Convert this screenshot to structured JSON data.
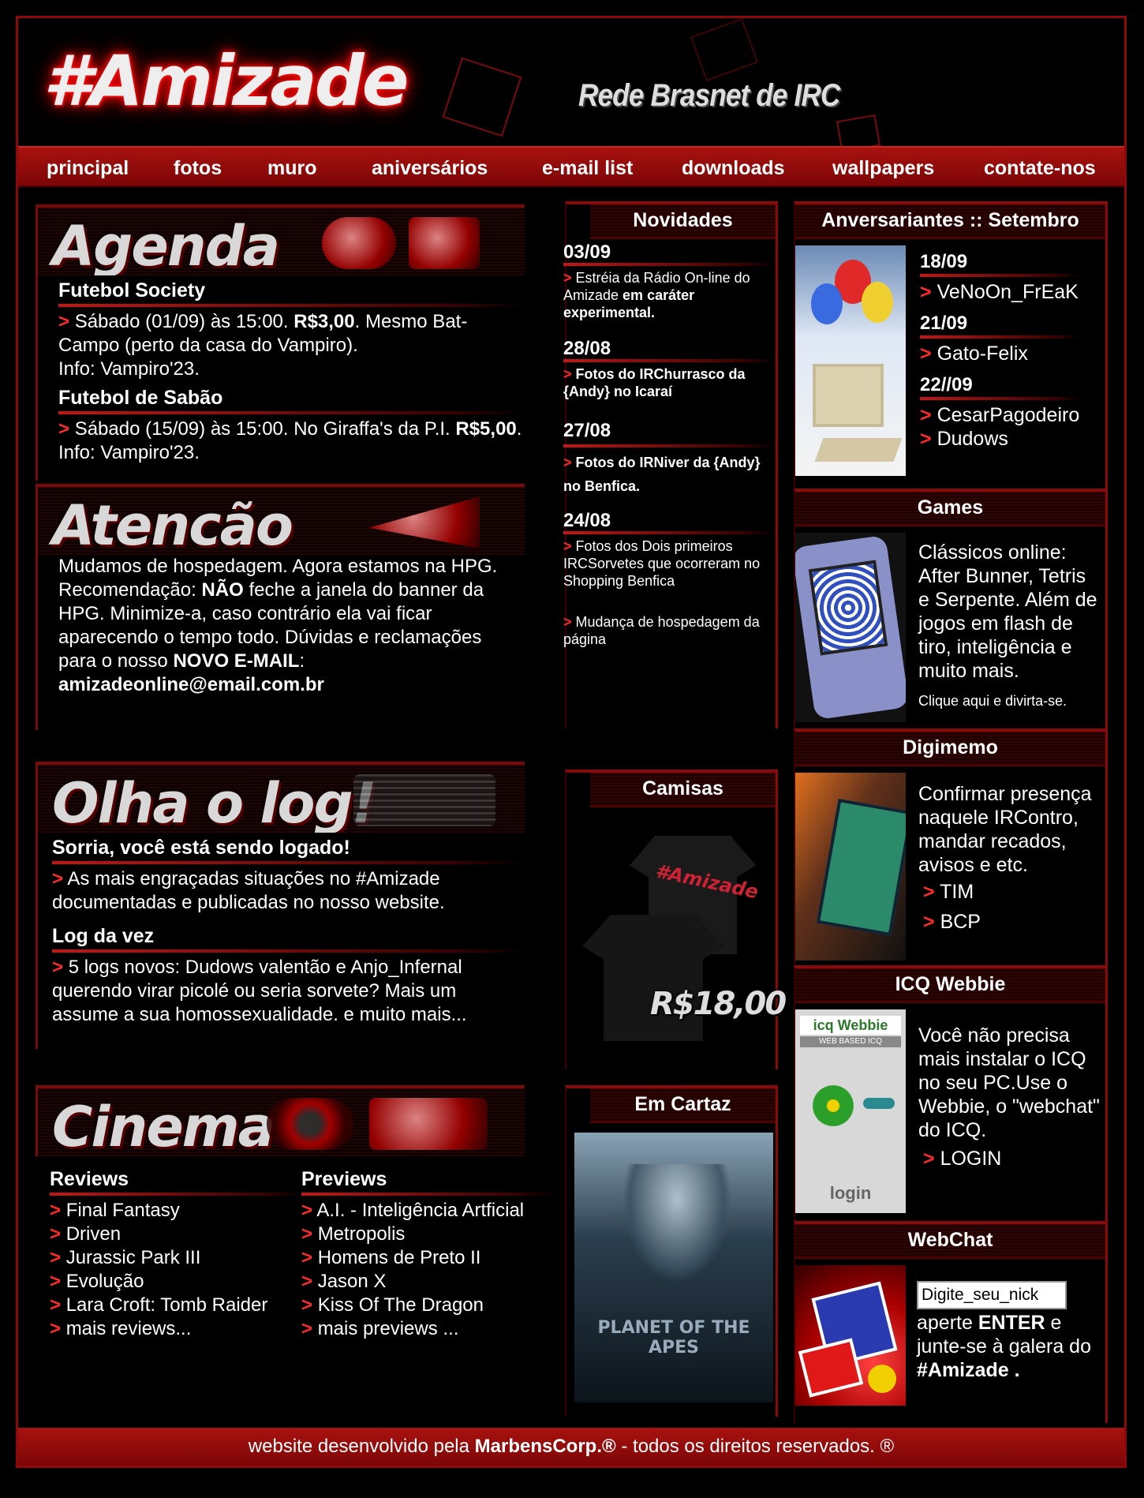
{
  "header": {
    "logo": "#Amizade",
    "tagline": "Rede Brasnet de IRC"
  },
  "nav": [
    {
      "label": "principal"
    },
    {
      "label": "fotos"
    },
    {
      "label": "muro"
    },
    {
      "label": "aniversários"
    },
    {
      "label": "e-mail list"
    },
    {
      "label": "downloads"
    },
    {
      "label": "wallpapers"
    },
    {
      "label": "contate-nos"
    }
  ],
  "agenda": {
    "title": "Agenda",
    "events": [
      {
        "title": "Futebol Society",
        "text1": "Sábado (01/09) às 15:00. ",
        "price": "R$3,00",
        "text2": ". Mesmo Bat-Campo (perto da casa do Vampiro).",
        "info": "Info: Vampiro'23."
      },
      {
        "title": "Futebol de Sabão",
        "text1": "Sábado (15/09) às 15:00. No Giraffa's da P.I.",
        "price": "R$5,00",
        "text2": ". Info: Vampiro'23."
      }
    ]
  },
  "atencao": {
    "title": "Atencão",
    "p1": "Mudamos de hospedagem. Agora estamos na HPG. Recomendação: ",
    "nao": "NÃO",
    "p2": " feche a janela do banner da HPG. Minimize-a, caso contrário ela vai ficar aparecendo o tempo todo. Dúvidas e reclamações para o nosso ",
    "novo": "NOVO E-MAIL",
    "colon": ":",
    "email": "amizadeonline@email.com.br"
  },
  "log": {
    "title": "Olha o log!",
    "sub1": "Sorria, você está sendo logado!",
    "text1": "As mais engraçadas situações no #Amizade documentadas e publicadas no nosso website.",
    "sub2": "Log da vez",
    "text2": "5 logs novos: Dudows valentão e Anjo_Infernal querendo virar picolé ou seria sorvete? Mais um assume a sua homossexualidade. e muito mais..."
  },
  "cinema": {
    "title": "Cinema",
    "reviews_title": "Reviews",
    "reviews": [
      "Final Fantasy",
      "Driven",
      "Jurassic Park III",
      "Evolução",
      "Lara Croft: Tomb Raider",
      "mais reviews..."
    ],
    "previews_title": "Previews",
    "previews": [
      "A.I. - Inteligência Artficial",
      "Metropolis",
      "Homens de Preto II",
      "Jason X",
      "Kiss Of The Dragon",
      "mais previews ..."
    ]
  },
  "novidades": {
    "title": "Novidades",
    "items": [
      {
        "date": "03/09",
        "text": "Estréia da Rádio On-line do Amizade ",
        "bold": "em caráter experimental."
      },
      {
        "date": "28/08",
        "text": "",
        "bold": "Fotos do IRChurrasco da {Andy} no Icaraí"
      },
      {
        "date": "27/08",
        "text": "",
        "bold": "Fotos do IRNiver da {Andy} no Benfica."
      },
      {
        "date": "24/08",
        "text": "Fotos dos Dois primeiros IRCSorvetes que ocorreram no Shopping Benfica",
        "bold": ""
      },
      {
        "date": "",
        "text": "Mudança de hospedagem da página",
        "bold": ""
      }
    ]
  },
  "camisas": {
    "title": "Camisas",
    "shirt_text": "#Amizade",
    "price": "R$18,00"
  },
  "cartaz": {
    "title": "Em Cartaz",
    "poster_title": "PLANET OF THE APES"
  },
  "aniversariantes": {
    "title": "Anversariantes :: Setembro",
    "groups": [
      {
        "date": "18/09",
        "names": [
          "VeNoOn_FrEaK"
        ]
      },
      {
        "date": "21/09",
        "names": [
          "Gato-Felix"
        ]
      },
      {
        "date": "22//09",
        "names": [
          "CesarPagodeiro",
          "Dudows"
        ]
      }
    ]
  },
  "games": {
    "title": "Games",
    "text": "Clássicos online: After Bunner, Tetris e Serpente. Além de jogos em flash de tiro, inteligência e muito mais.",
    "cta": "Clique aqui e divirta-se."
  },
  "digimemo": {
    "title": "Digimemo",
    "text": "Confirmar presença naquele IRContro, mandar recados, avisos e etc.",
    "links": [
      "TIM",
      "BCP"
    ]
  },
  "icq": {
    "title": "ICQ Webbie",
    "logo_text": "icq Webbie",
    "logo_sub": "WEB BASED ICQ",
    "login_img": "login",
    "text": "Você não precisa mais instalar o ICQ no seu PC.Use o Webbie, o \"webchat\" do ICQ.",
    "link": "LOGIN"
  },
  "webchat": {
    "title": "WebChat",
    "nick_value": "Digite_seu_nick",
    "t1": "aperte ",
    "enter": "ENTER",
    "t2": " e junte-se à galera do ",
    "channel": "#Amizade ."
  },
  "footer": {
    "t1": "website desenvolvido pela ",
    "brand": "MarbensCorp.®",
    "t2": " - todos os direitos reservados. ®"
  },
  "colors": {
    "accent": "#a8120f",
    "bullet": "#ff2a2a",
    "background": "#000000"
  }
}
